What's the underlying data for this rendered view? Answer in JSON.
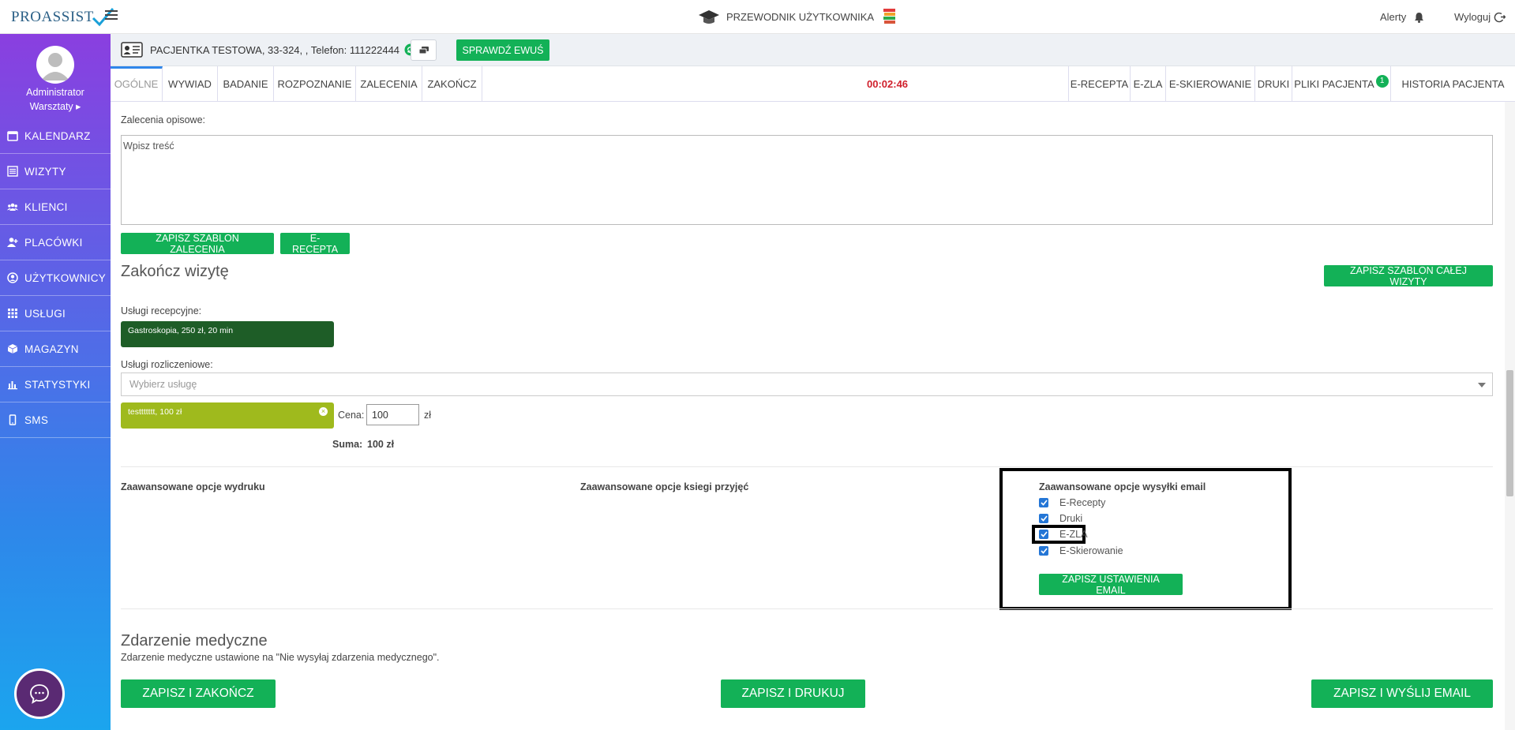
{
  "header": {
    "logo_text": "PROASSIST",
    "guide_label": "PRZEWODNIK UŻYTKOWNIKA",
    "alerts_label": "Alerty",
    "logout_label": "Wyloguj"
  },
  "sidebar": {
    "user_name": "Administrator",
    "user_location": "Warsztaty ▸",
    "items": [
      {
        "label": "KALENDARZ",
        "icon": "calendar-icon"
      },
      {
        "label": "WIZYTY",
        "icon": "list-icon"
      },
      {
        "label": "KLIENCI",
        "icon": "users-icon"
      },
      {
        "label": "PLACÓWKI",
        "icon": "user-plus-icon"
      },
      {
        "label": "UŻYTKOWNICY",
        "icon": "user-circle-icon"
      },
      {
        "label": "USŁUGI",
        "icon": "grid-icon"
      },
      {
        "label": "MAGAZYN",
        "icon": "box-icon"
      },
      {
        "label": "STATYSTYKI",
        "icon": "bar-chart-icon"
      },
      {
        "label": "SMS",
        "icon": "phone-icon"
      }
    ]
  },
  "patient": {
    "info": "PACJENTKA TESTOWA, 33-324, , Telefon: 111222444",
    "ewus_label": "SPRAWDŹ EWUŚ"
  },
  "tabs": {
    "left": [
      "OGÓLNE",
      "WYWIAD",
      "BADANIE",
      "ROZPOZNANIE",
      "ZALECENIA",
      "ZAKOŃCZ"
    ],
    "timer": "00:02:46",
    "right": [
      "E-RECEPTA",
      "E-ZLA",
      "E-SKIEROWANIE",
      "DRUKI",
      "PLIKI PACJENTA",
      "HISTORIA PACJENTA"
    ],
    "files_badge": "1"
  },
  "recommendations": {
    "label": "Zalecenia opisowe:",
    "placeholder": "Wpisz treść",
    "save_template_label": "ZAPISZ SZABLON ZALECENIA",
    "erecepta_label": "E-RECEPTA"
  },
  "finish": {
    "title": "Zakończ wizytę",
    "save_visit_template_label": "ZAPISZ SZABLON CAŁEJ WIZYTY",
    "reception_label": "Usługi recepcyjne:",
    "reception_service": "Gastroskopia, 250 zł, 20 min",
    "billing_label": "Usługi rozliczeniowe:",
    "select_placeholder": "Wybierz usługę",
    "billing_service": "testtttttt, 100 zł",
    "price_label": "Cena:",
    "price_value": "100",
    "currency": "zł",
    "sum_label": "Suma:",
    "sum_value": "100 zł"
  },
  "options": {
    "print_title": "Zaawansowane opcje wydruku",
    "book_title": "Zaawansowane opcje ksiegi przyjęć",
    "email_title": "Zaawansowane opcje wysyłki email",
    "email_items": [
      "E-Recepty",
      "Druki",
      "E-ZLA",
      "E-Skierowanie"
    ],
    "save_email_label": "ZAPISZ USTAWIENIA EMAIL"
  },
  "medical_event": {
    "title": "Zdarzenie medyczne",
    "description": "Zdarzenie medyczne ustawione na \"Nie wysyłaj zdarzenia medycznego\"."
  },
  "actions": {
    "save_finish": "ZAPISZ I ZAKOŃCZ",
    "save_print": "ZAPISZ I DRUKUJ",
    "save_email": "ZAPISZ I WYŚLIJ EMAIL"
  }
}
